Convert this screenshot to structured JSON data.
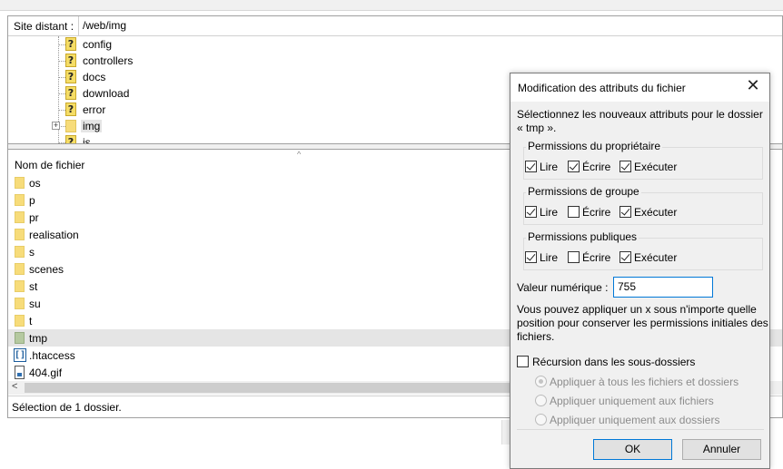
{
  "remote": {
    "path_label": "Site distant :",
    "path_value": "/web/img",
    "tree": [
      {
        "label": "config",
        "icon": "question-folder-icon"
      },
      {
        "label": "controllers",
        "icon": "question-folder-icon"
      },
      {
        "label": "docs",
        "icon": "question-folder-icon"
      },
      {
        "label": "download",
        "icon": "question-folder-icon"
      },
      {
        "label": "error",
        "icon": "question-folder-icon"
      },
      {
        "label": "img",
        "icon": "folder-icon",
        "selected": true,
        "expander": "+"
      },
      {
        "label": "js",
        "icon": "question-folder-icon"
      }
    ],
    "sort_arrow": "^",
    "column_header": "Nom de fichier",
    "files": [
      {
        "name": "os",
        "icon": "folder-icon"
      },
      {
        "name": "p",
        "icon": "folder-icon"
      },
      {
        "name": "pr",
        "icon": "folder-icon"
      },
      {
        "name": "realisation",
        "icon": "folder-icon"
      },
      {
        "name": "s",
        "icon": "folder-icon"
      },
      {
        "name": "scenes",
        "icon": "folder-icon"
      },
      {
        "name": "st",
        "icon": "folder-icon"
      },
      {
        "name": "su",
        "icon": "folder-icon"
      },
      {
        "name": "t",
        "icon": "folder-icon"
      },
      {
        "name": "tmp",
        "icon": "folder-icon",
        "selected": true
      },
      {
        "name": ".htaccess",
        "icon": "htaccess-file-icon"
      },
      {
        "name": "404.gif",
        "icon": "image-file-icon"
      }
    ],
    "scroll_left": "<",
    "status": "Sélection de 1 dossier."
  },
  "dialog": {
    "title": "Modification des attributs du fichier",
    "close_glyph": "✕",
    "intro": "Sélectionnez les nouveaux attributs pour le dossier « tmp ».",
    "groups": [
      {
        "title": "Permissions du propriétaire",
        "read": {
          "label": "Lire",
          "checked": true
        },
        "write": {
          "label": "Écrire",
          "checked": true
        },
        "exec": {
          "label": "Exécuter",
          "checked": true
        }
      },
      {
        "title": "Permissions de groupe",
        "read": {
          "label": "Lire",
          "checked": true
        },
        "write": {
          "label": "Écrire",
          "checked": false
        },
        "exec": {
          "label": "Exécuter",
          "checked": true
        }
      },
      {
        "title": "Permissions publiques",
        "read": {
          "label": "Lire",
          "checked": true
        },
        "write": {
          "label": "Écrire",
          "checked": false
        },
        "exec": {
          "label": "Exécuter",
          "checked": true
        }
      }
    ],
    "numeric_label": "Valeur numérique :",
    "numeric_value": "755",
    "note": "Vous pouvez appliquer un x sous n'importe quelle position pour conserver les permissions initiales des fichiers.",
    "recursion_label": "Récursion dans les sous-dossiers",
    "recursion_checked": false,
    "radios": [
      {
        "label": "Appliquer à tous les fichiers et dossiers",
        "selected": true
      },
      {
        "label": "Appliquer uniquement aux fichiers",
        "selected": false
      },
      {
        "label": "Appliquer uniquement aux dossiers",
        "selected": false
      }
    ],
    "ok_label": "OK",
    "cancel_label": "Annuler"
  }
}
